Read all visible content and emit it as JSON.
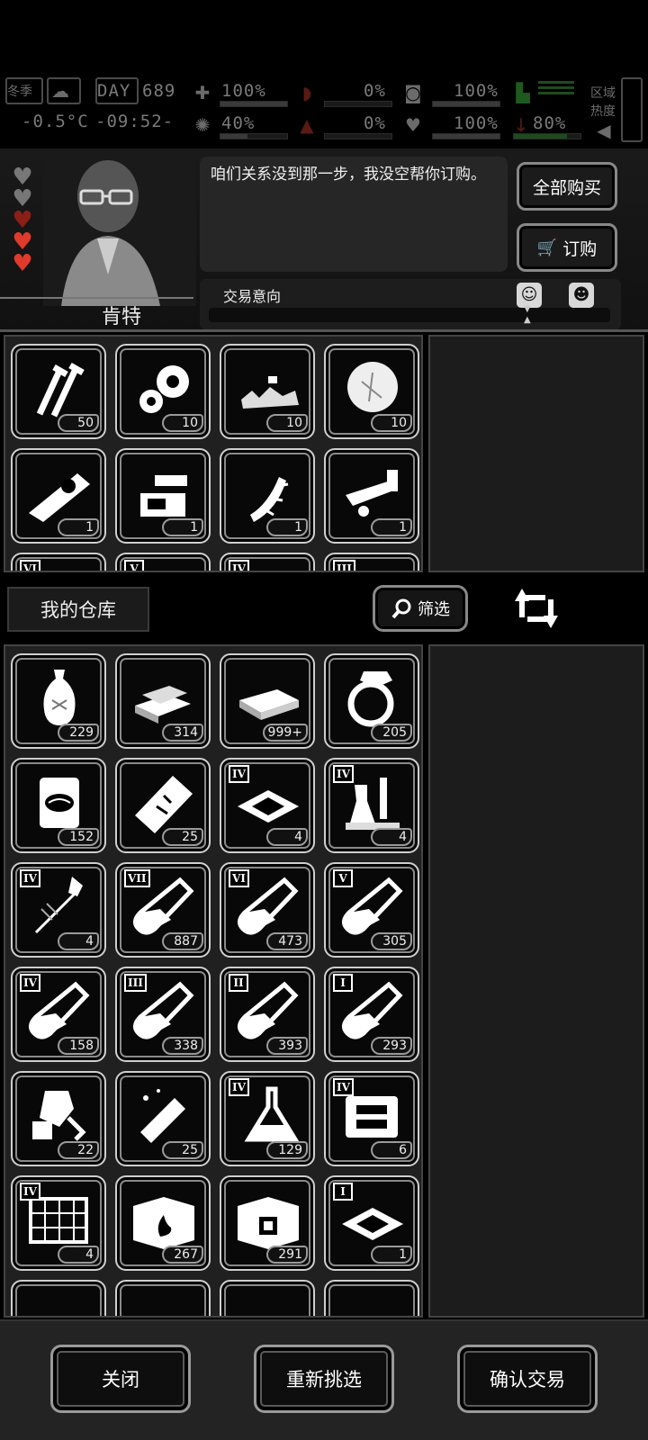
{
  "hud": {
    "season": "冬季",
    "temperature": "-0.5°C",
    "day_label": "DAY",
    "day_number": "689",
    "time": "-09:52-",
    "health_pct": "100%",
    "health_bar": 1.0,
    "mind_pct": "40%",
    "mind_bar": 0.4,
    "hunger_pct": "0%",
    "hunger_bar": 0.0,
    "thirst_pct": "0%",
    "thirst_bar": 0.0,
    "stomach_pct": "100%",
    "stomach_bar": 1.0,
    "heart_pct": "100%",
    "heart_bar": 1.0,
    "stamina_pct": "80%",
    "stamina_bar": 0.8,
    "region_label": "区域",
    "heat_label": "热度"
  },
  "npc": {
    "name": "肯特",
    "hearts": [
      "empty",
      "empty",
      "dim",
      "full",
      "full"
    ],
    "dialog": "咱们关系没到那一步，我没空帮你订购。",
    "buy_all_label": "全部购买",
    "order_label": "订购",
    "trade_intent_label": "交易意向",
    "colors": {
      "heart_full": "#e03a2a",
      "heart_dim": "#8a1f18",
      "heart_empty": "#777777"
    }
  },
  "merchant_items": [
    {
      "icon": "screws-icon",
      "count": "50"
    },
    {
      "icon": "gears-icon",
      "count": "10"
    },
    {
      "icon": "debris-icon",
      "count": "10"
    },
    {
      "icon": "fluff-icon",
      "count": "10"
    },
    {
      "icon": "chainsaw-part-icon",
      "count": "1"
    },
    {
      "icon": "bench-vise-icon",
      "count": "1"
    },
    {
      "icon": "spiked-bat-icon",
      "count": "1"
    },
    {
      "icon": "hose-nozzle-icon",
      "count": "1"
    }
  ],
  "merchant_partial_tiers": [
    "VI",
    "V",
    "IV",
    "III"
  ],
  "warehouse": {
    "title": "我的仓库",
    "filter_label": "筛选",
    "items": [
      {
        "icon": "vase-icon",
        "tier": "",
        "count": "229"
      },
      {
        "icon": "gold-bars-icon",
        "tier": "",
        "count": "314"
      },
      {
        "icon": "cash-stack-icon",
        "tier": "",
        "count": "999+"
      },
      {
        "icon": "diamond-ring-icon",
        "tier": "",
        "count": "205"
      },
      {
        "icon": "canned-food-icon",
        "tier": "",
        "count": "152"
      },
      {
        "icon": "ticket-icon",
        "tier": "",
        "count": "25"
      },
      {
        "icon": "chip-icon",
        "tier": "IV",
        "count": "4"
      },
      {
        "icon": "lab-flask-icon",
        "tier": "IV",
        "count": "4"
      },
      {
        "icon": "crystal-wand-icon",
        "tier": "IV",
        "count": "4"
      },
      {
        "icon": "test-tube-icon",
        "tier": "VII",
        "count": "887"
      },
      {
        "icon": "test-tube-icon",
        "tier": "VI",
        "count": "473"
      },
      {
        "icon": "test-tube-icon",
        "tier": "V",
        "count": "305"
      },
      {
        "icon": "test-tube-icon",
        "tier": "IV",
        "count": "158"
      },
      {
        "icon": "test-tube-icon",
        "tier": "III",
        "count": "338"
      },
      {
        "icon": "test-tube-icon",
        "tier": "II",
        "count": "393"
      },
      {
        "icon": "test-tube-icon",
        "tier": "I",
        "count": "293"
      },
      {
        "icon": "broken-robot-icon",
        "tier": "",
        "count": "22"
      },
      {
        "icon": "broken-arm-icon",
        "tier": "",
        "count": "25"
      },
      {
        "icon": "erlenmeyer-icon",
        "tier": "IV",
        "count": "129"
      },
      {
        "icon": "machine-icon",
        "tier": "IV",
        "count": "6"
      },
      {
        "icon": "circuit-board-icon",
        "tier": "IV",
        "count": "4"
      },
      {
        "icon": "crate-fire-icon",
        "tier": "",
        "count": "267"
      },
      {
        "icon": "crate-chip-icon",
        "tier": "",
        "count": "291"
      },
      {
        "icon": "chip-icon",
        "tier": "I",
        "count": "1"
      }
    ]
  },
  "bottom": {
    "close_label": "关闭",
    "reselect_label": "重新挑选",
    "confirm_label": "确认交易"
  }
}
